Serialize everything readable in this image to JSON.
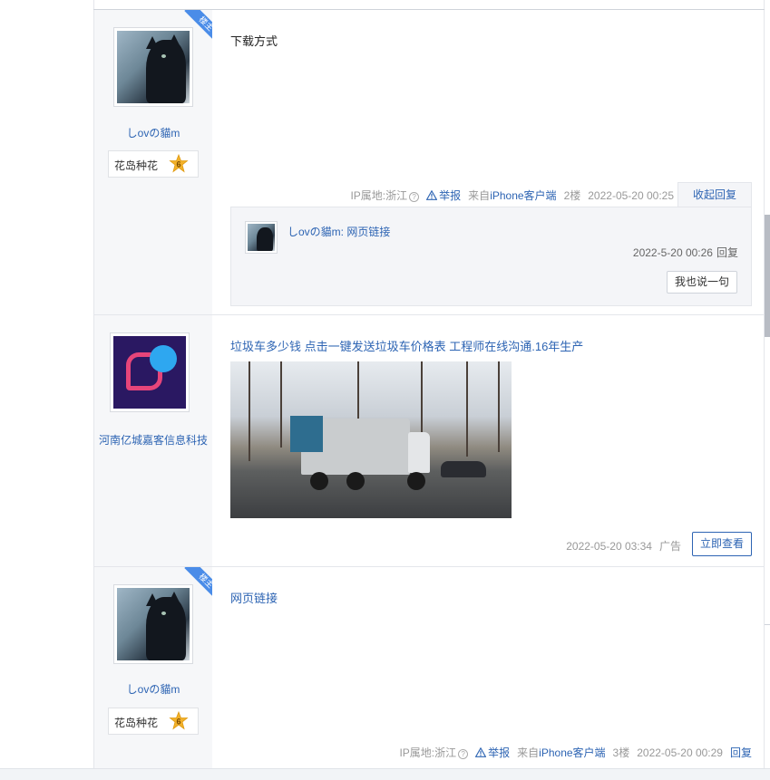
{
  "posts": [
    {
      "badge": "楼主",
      "username": "しovの貓m",
      "level_name": "花岛种花",
      "level_num": "6",
      "text": "下载方式",
      "meta": {
        "ip": "IP属地:浙江",
        "report": "举报",
        "client_prefix": "来自",
        "client": "iPhone客户端",
        "floor": "2楼",
        "time": "2022-05-20 00:25"
      },
      "collapse_label": "收起回复",
      "sub_reply": {
        "author": "しovの貓m:",
        "text": "网页链接",
        "time": "2022-5-20 00:26",
        "reply_label": "回复",
        "say_button": "我也说一句"
      }
    },
    {
      "badge": "楼主",
      "username": "しovの貓m",
      "level_name": "花岛种花",
      "level_num": "6",
      "text": "网页链接",
      "meta": {
        "ip": "IP属地:浙江",
        "report": "举报",
        "client_prefix": "来自",
        "client": "iPhone客户端",
        "floor": "3楼",
        "time": "2022-05-20 00:29",
        "reply": "回复"
      }
    }
  ],
  "ad": {
    "username": "河南亿城嘉客信息科技",
    "title": "垃圾车多少钱 点击一键发送垃圾车价格表 工程师在线沟通.16年生产",
    "time": "2022-05-20 03:34",
    "ad_label": "广告",
    "button": "立即查看"
  },
  "icons": {
    "warning": "warning-icon",
    "question": "question-icon",
    "level_star": "star-badge-icon"
  },
  "colors": {
    "link": "#2d64b3",
    "badge": "#4a8ce8",
    "star": "#f2b12a"
  }
}
